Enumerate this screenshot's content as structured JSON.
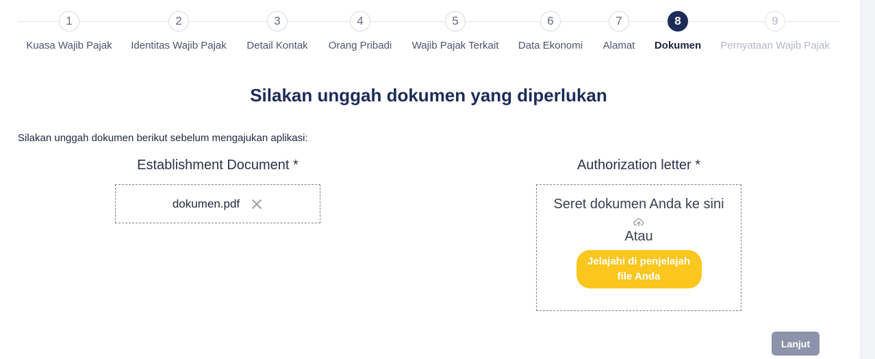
{
  "stepper": {
    "steps": [
      {
        "number": "1",
        "label": "Kuasa Wajib Pajak",
        "state": "done"
      },
      {
        "number": "2",
        "label": "Identitas Wajib Pajak",
        "state": "done"
      },
      {
        "number": "3",
        "label": "Detail Kontak",
        "state": "done"
      },
      {
        "number": "4",
        "label": "Orang Pribadi",
        "state": "done"
      },
      {
        "number": "5",
        "label": "Wajib Pajak Terkait",
        "state": "done"
      },
      {
        "number": "6",
        "label": "Data Ekonomi",
        "state": "done"
      },
      {
        "number": "7",
        "label": "Alamat",
        "state": "done"
      },
      {
        "number": "8",
        "label": "Dokumen",
        "state": "active"
      },
      {
        "number": "9",
        "label": "Pernyataan Wajib Pajak",
        "state": "disabled"
      }
    ]
  },
  "page": {
    "title": "Silakan unggah dokumen yang diperlukan",
    "instruction": "Silakan unggah dokumen berikut sebelum mengajukan aplikasi:"
  },
  "documents": {
    "establishment": {
      "label": "Establishment Document *",
      "file_name": "dokumen.pdf"
    },
    "authorization": {
      "label": "Authorization letter *",
      "drop_hint": "Seret dokumen Anda ke sini",
      "or_text": "Atau",
      "browse_line1": "Jelajahi di penjelajah",
      "browse_line2": "file Anda"
    }
  },
  "footer": {
    "next_label": "Lanjut"
  },
  "colors": {
    "primary": "#1d2b57",
    "accent": "#fbc61d",
    "button_disabled": "#8d93ab"
  },
  "icons": {
    "remove": "close-icon",
    "upload": "cloud-upload-icon"
  }
}
